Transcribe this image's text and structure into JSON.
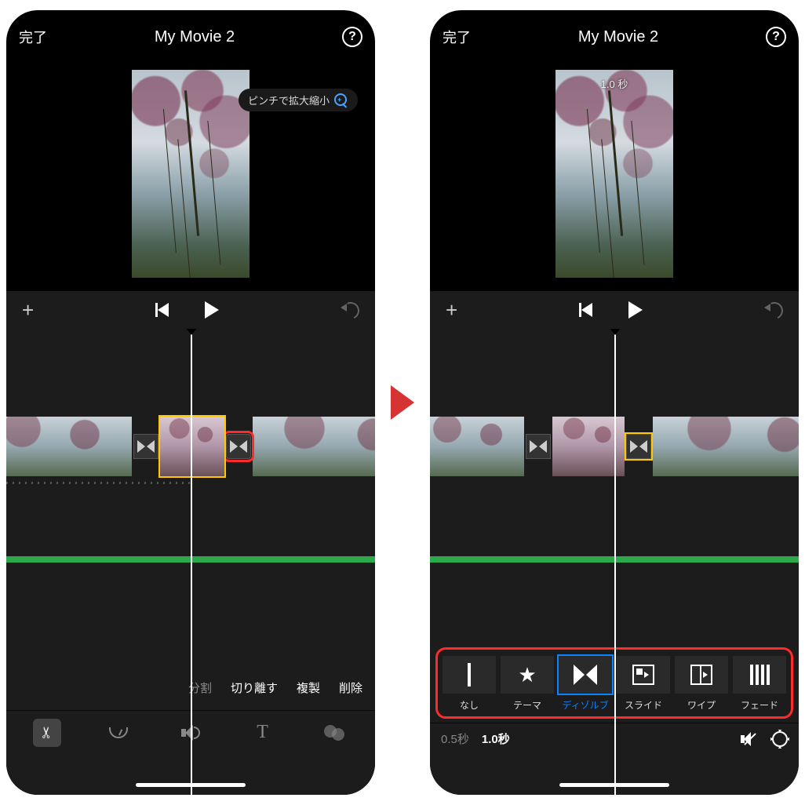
{
  "left": {
    "header": {
      "done": "完了",
      "title": "My Movie 2",
      "help": "?"
    },
    "tooltip": "ピンチで拡大縮小",
    "editActions": {
      "split": "分割",
      "detach": "切り離す",
      "duplicate": "複製",
      "delete": "削除"
    }
  },
  "right": {
    "header": {
      "done": "完了",
      "title": "My Movie 2",
      "help": "?"
    },
    "previewDuration": "1.0 秒",
    "transitions": {
      "none": "なし",
      "theme": "テーマ",
      "dissolve": "ディゾルブ",
      "slide": "スライド",
      "wipe": "ワイプ",
      "fade": "フェード"
    },
    "durations": {
      "opt1": "0.5秒",
      "opt2": "1.0秒"
    }
  }
}
